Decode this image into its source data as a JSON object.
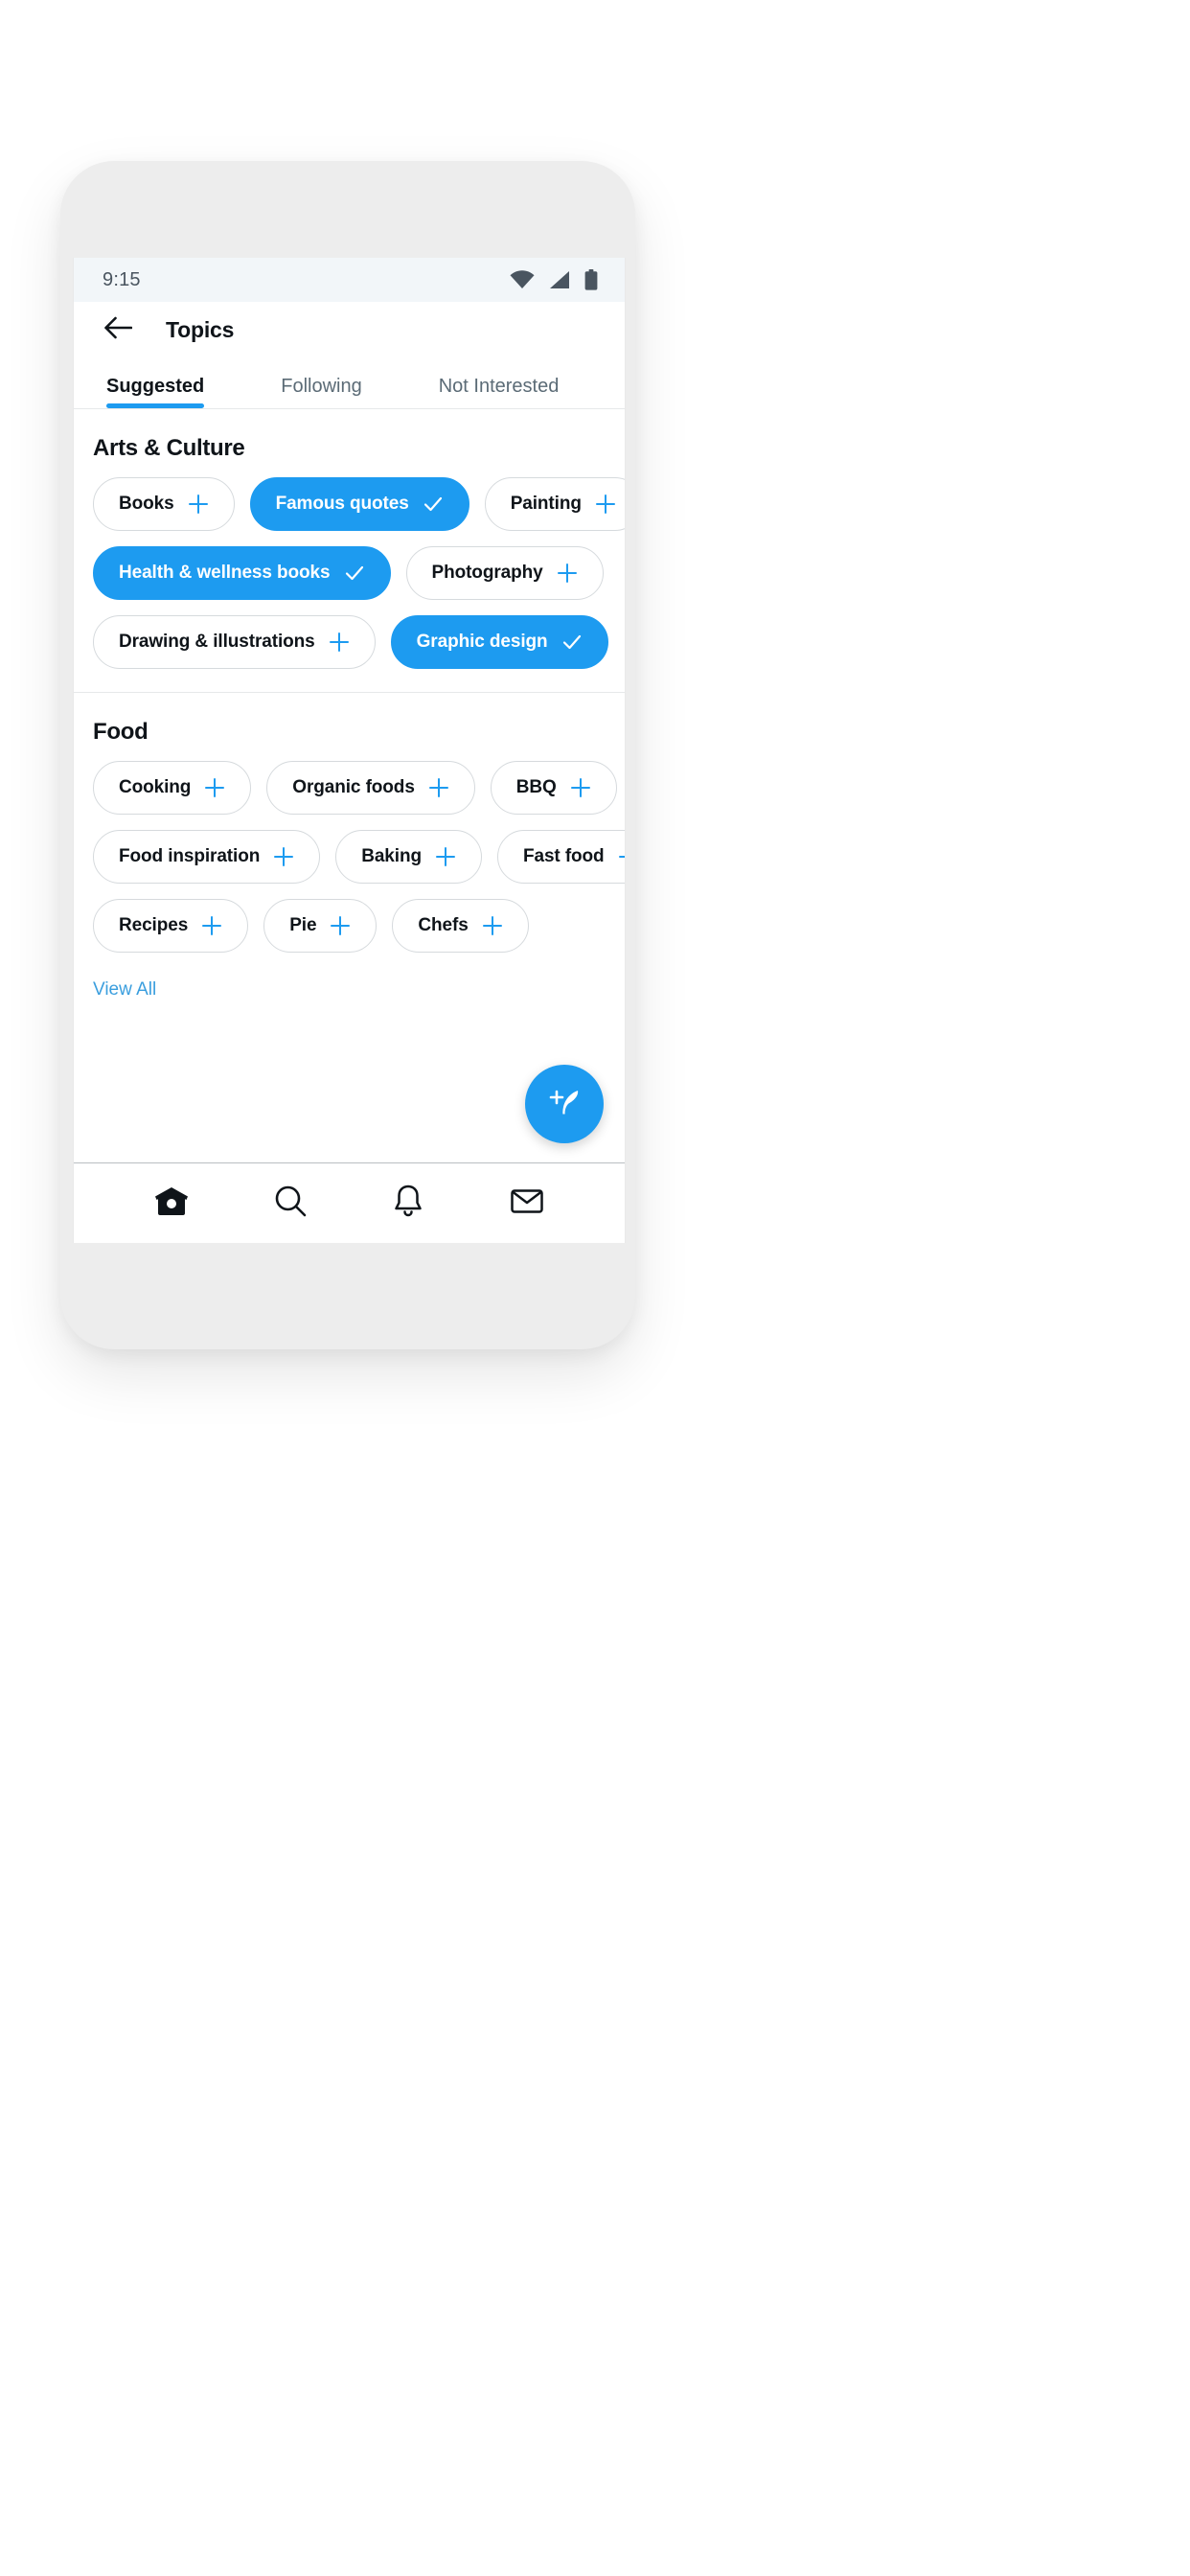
{
  "statusbar": {
    "time": "9:15",
    "icons": [
      "wifi-icon",
      "cellular-signal-icon",
      "battery-icon"
    ]
  },
  "appbar": {
    "back_icon": "arrow-left-icon",
    "title": "Topics"
  },
  "tabs": [
    {
      "label": "Suggested",
      "active": true
    },
    {
      "label": "Following",
      "active": false
    },
    {
      "label": "Not Interested",
      "active": false
    }
  ],
  "sections": [
    {
      "title": "Arts & Culture",
      "rows": [
        [
          {
            "label": "Books",
            "selected": false
          },
          {
            "label": "Famous quotes",
            "selected": true
          },
          {
            "label": "Painting",
            "selected": false
          }
        ],
        [
          {
            "label": "Health & wellness books",
            "selected": true
          },
          {
            "label": "Photography",
            "selected": false
          }
        ],
        [
          {
            "label": "Drawing & illustrations",
            "selected": false
          },
          {
            "label": "Graphic design",
            "selected": true
          }
        ]
      ]
    },
    {
      "title": "Food",
      "rows": [
        [
          {
            "label": "Cooking",
            "selected": false
          },
          {
            "label": "Organic foods",
            "selected": false
          },
          {
            "label": "BBQ",
            "selected": false
          }
        ],
        [
          {
            "label": "Food inspiration",
            "selected": false
          },
          {
            "label": "Baking",
            "selected": false
          },
          {
            "label": "Fast food",
            "selected": false
          }
        ],
        [
          {
            "label": "Recipes",
            "selected": false
          },
          {
            "label": "Pie",
            "selected": false
          },
          {
            "label": "Chefs",
            "selected": false
          }
        ]
      ],
      "view_all": "View All"
    }
  ],
  "fab": {
    "icon": "compose-feather-icon"
  },
  "bottomnav": [
    {
      "icon": "home-icon",
      "active": true
    },
    {
      "icon": "search-icon",
      "active": false
    },
    {
      "icon": "bell-icon",
      "active": false
    },
    {
      "icon": "mail-icon",
      "active": false
    }
  ],
  "colors": {
    "accent": "#1d9bf0",
    "text": "#0f1419",
    "muted": "#5b6b76",
    "chip_border": "#d6dadd",
    "link": "#3a9ede"
  }
}
